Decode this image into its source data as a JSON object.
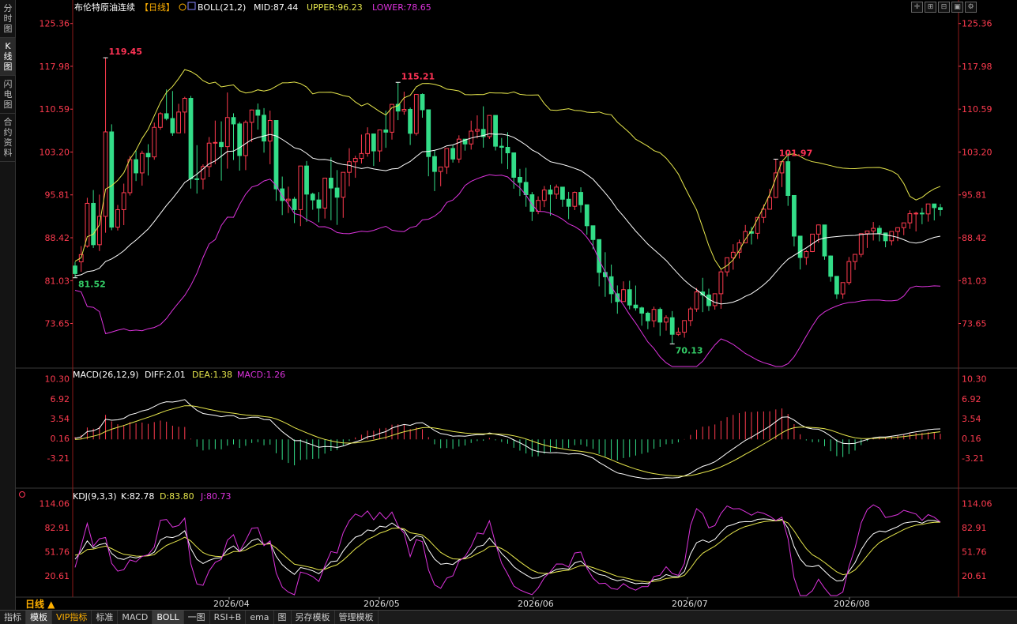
{
  "sidebar": {
    "tabs": [
      {
        "label": "分时图",
        "active": false
      },
      {
        "label": "K线图",
        "active": true
      },
      {
        "label": "闪电图",
        "active": false
      },
      {
        "label": "合约资料",
        "active": false
      }
    ]
  },
  "toolbar_icons": [
    "crosshair-icon",
    "zoom-in-icon",
    "zoom-out-icon",
    "fit-icon",
    "settings-icon"
  ],
  "price_panel": {
    "title": "布伦特原油连续",
    "period_tag": "【日线】",
    "indicator": "BOLL(21,2)",
    "mid_label": "MID:87.44",
    "upper_label": "UPPER:96.23",
    "lower_label": "LOWER:78.65",
    "axis_ticks": [
      "125.36",
      "117.98",
      "110.59",
      "103.20",
      "95.81",
      "88.42",
      "81.03",
      "73.65"
    ],
    "annotations": [
      {
        "text": "119.45",
        "color": "#ff3355"
      },
      {
        "text": "115.21",
        "color": "#ff3355"
      },
      {
        "text": "101.97",
        "color": "#ff3355"
      },
      {
        "text": "81.52",
        "color": "#33cc66"
      },
      {
        "text": "70.13",
        "color": "#33cc66"
      }
    ]
  },
  "macd_panel": {
    "indicator": "MACD(26,12,9)",
    "diff_label": "DIFF:2.01",
    "dea_label": "DEA:1.38",
    "macd_label": "MACD:1.26",
    "axis_ticks": [
      "10.30",
      "6.92",
      "3.54",
      "0.16",
      "-3.21"
    ]
  },
  "kdj_panel": {
    "indicator": "KDJ(9,3,3)",
    "k_label": "K:82.78",
    "d_label": "D:83.80",
    "j_label": "J:80.73",
    "axis_ticks": [
      "114.06",
      "82.91",
      "51.76",
      "20.61"
    ]
  },
  "x_axis": {
    "period_button": "日线 ▲",
    "dates": [
      "2026/04",
      "2026/05",
      "2026/06",
      "2026/07",
      "2026/08"
    ]
  },
  "bottom_tabs": [
    {
      "label": "指标",
      "active": false
    },
    {
      "label": "模板",
      "active": true
    },
    {
      "label": "VIP指标",
      "active": false,
      "vip": true
    },
    {
      "label": "标准",
      "active": false
    },
    {
      "label": "MACD",
      "active": false
    },
    {
      "label": "BOLL",
      "active": true
    },
    {
      "label": "一图",
      "active": false
    },
    {
      "label": "RSI+B",
      "active": false
    },
    {
      "label": "ema",
      "active": false
    },
    {
      "label": "图",
      "active": false
    },
    {
      "label": "另存模板",
      "active": false
    },
    {
      "label": "管理模板",
      "active": false
    }
  ],
  "colors": {
    "up": "#ff3b4f",
    "down": "#33dd88",
    "mid": "#ffffff",
    "upper": "#e6e64c",
    "lower": "#dd33dd",
    "axis": "#ff3b4f"
  },
  "chart_data": {
    "type": "candlestick",
    "instrument": "布伦特原油连续",
    "period": "日线",
    "price_range": [
      66.5,
      127.5
    ],
    "candles_ohlc": [
      [
        83.56,
        84.27,
        82.24,
        81.52
      ],
      [
        84.27,
        86.98,
        85.52,
        82.56
      ],
      [
        86.98,
        95.31,
        94.35,
        86.72
      ],
      [
        94.35,
        96.65,
        87.22,
        86.66
      ],
      [
        87.22,
        95.86,
        92.11,
        86.13
      ],
      [
        92.11,
        119.45,
        106.67,
        89.29
      ],
      [
        106.67,
        107.97,
        90.25,
        89.72
      ],
      [
        90.25,
        94.07,
        93.26,
        89.67
      ],
      [
        93.26,
        97.75,
        96.19,
        90.6
      ],
      [
        96.19,
        102.51,
        101.89,
        95.7
      ],
      [
        101.89,
        103.43,
        99.6,
        98.2
      ],
      [
        99.6,
        103.43,
        102.97,
        97.4
      ],
      [
        102.97,
        104.55,
        102.36,
        99.15
      ],
      [
        102.36,
        108.27,
        107.45,
        101.88
      ],
      [
        107.45,
        110.07,
        109.81,
        107.04
      ],
      [
        109.81,
        113.99,
        108.98,
        108.67
      ],
      [
        108.98,
        113.71,
        106.51,
        105.99
      ],
      [
        106.51,
        111.51,
        110.09,
        106.53
      ],
      [
        110.09,
        112.72,
        112.45,
        106.42
      ],
      [
        112.45,
        112.87,
        98.59,
        96.9
      ],
      [
        98.59,
        104.38,
        98.53,
        96.04
      ],
      [
        98.53,
        101.07,
        100.69,
        96.76
      ],
      [
        100.69,
        105.78,
        104.73,
        98.91
      ],
      [
        104.73,
        108.62,
        104.86,
        101.12
      ],
      [
        104.86,
        108.49,
        104.13,
        98.27
      ],
      [
        104.13,
        113.46,
        109.15,
        100.33
      ],
      [
        109.15,
        109.88,
        108.04,
        101.82
      ],
      [
        108.04,
        108.4,
        102.59,
        99.99
      ],
      [
        102.59,
        108.66,
        108.32,
        100.08
      ],
      [
        108.32,
        110.52,
        110.45,
        104.91
      ],
      [
        110.45,
        111.56,
        109.54,
        107.06
      ],
      [
        109.54,
        110.77,
        105.09,
        103.09
      ],
      [
        105.09,
        110.34,
        108.64,
        101.1
      ],
      [
        108.64,
        100.88,
        96.85,
        94.78
      ],
      [
        96.85,
        98.97,
        94.84,
        92.33
      ],
      [
        94.84,
        97.23,
        95.07,
        92.69
      ],
      [
        95.07,
        95.47,
        93.27,
        90.95
      ],
      [
        93.27,
        92.82,
        100.79,
        90.43
      ],
      [
        100.79,
        101.65,
        95.94,
        91.18
      ],
      [
        95.94,
        96.19,
        94.94,
        93.25
      ],
      [
        94.94,
        96.29,
        93.54,
        91.09
      ],
      [
        93.54,
        98.51,
        98.7,
        91.73
      ],
      [
        98.7,
        102.27,
        96.99,
        91.43
      ],
      [
        96.99,
        100.09,
        95.41,
        90.64
      ],
      [
        95.41,
        95.59,
        99.7,
        91.86
      ],
      [
        99.7,
        103.86,
        101.53,
        97.29
      ],
      [
        101.53,
        102.56,
        102.1,
        98.76
      ],
      [
        102.1,
        106.21,
        102.94,
        101.23
      ],
      [
        102.94,
        107.46,
        106.32,
        102.4
      ],
      [
        106.32,
        106.18,
        103.39,
        100.79
      ],
      [
        103.39,
        106.32,
        107.01,
        101.52
      ],
      [
        107.01,
        110.33,
        106.62,
        103.93
      ],
      [
        106.62,
        109.01,
        111.42,
        105.34
      ],
      [
        111.42,
        115.21,
        110.26,
        108.7
      ],
      [
        110.26,
        113.6,
        110.55,
        109.64
      ],
      [
        110.55,
        110.86,
        106.42,
        104.41
      ],
      [
        106.42,
        108.57,
        113.13,
        106.04
      ],
      [
        113.13,
        113.31,
        110.48,
        109.11
      ],
      [
        110.48,
        107.17,
        102.42,
        99.02
      ],
      [
        102.42,
        103.49,
        99.85,
        96.46
      ],
      [
        99.85,
        100.51,
        100.62,
        97.3
      ],
      [
        100.62,
        102.72,
        103.82,
        99.43
      ],
      [
        103.82,
        104.39,
        101.99,
        101.38
      ],
      [
        101.99,
        106.08,
        105.42,
        101.33
      ],
      [
        105.42,
        105.42,
        104.59,
        103.44
      ],
      [
        104.59,
        108.61,
        106.8,
        103.62
      ],
      [
        106.8,
        109.52,
        107.1,
        105.55
      ],
      [
        107.1,
        111.08,
        105.85,
        103.95
      ],
      [
        105.85,
        109.46,
        109.51,
        105.45
      ],
      [
        109.51,
        108.86,
        104.2,
        103.47
      ],
      [
        104.2,
        105.62,
        104.01,
        101.2
      ],
      [
        104.01,
        106.62,
        103.06,
        100.25
      ],
      [
        103.06,
        102.25,
        98.84,
        96.88
      ],
      [
        98.84,
        100.3,
        97.97,
        95.61
      ],
      [
        97.97,
        100.48,
        95.84,
        93.77
      ],
      [
        95.84,
        96.3,
        92.98,
        91.31
      ],
      [
        92.98,
        95.56,
        94.86,
        92.48
      ],
      [
        94.86,
        97.34,
        96.66,
        93.71
      ],
      [
        96.66,
        97.55,
        95.94,
        92.22
      ],
      [
        95.94,
        97.6,
        97.15,
        95.1
      ],
      [
        97.15,
        96.79,
        95.06,
        93.76
      ],
      [
        95.06,
        96.33,
        93.84,
        91.63
      ],
      [
        93.84,
        96.4,
        96.24,
        93.19
      ],
      [
        96.24,
        97.12,
        94.11,
        92.74
      ],
      [
        94.11,
        93.33,
        90.49,
        88.94
      ],
      [
        90.49,
        90.38,
        88.11,
        86.44
      ],
      [
        88.11,
        85.86,
        82.45,
        80.05
      ],
      [
        82.45,
        85.93,
        81.7,
        78.24
      ],
      [
        81.7,
        83.8,
        78.77,
        77.15
      ],
      [
        78.77,
        80.2,
        77.42,
        75.33
      ],
      [
        77.42,
        80.91,
        79.47,
        77.6
      ],
      [
        79.47,
        81.01,
        76.82,
        76.08
      ],
      [
        76.82,
        80.18,
        76.33,
        75.85
      ],
      [
        76.33,
        76.55,
        75.42,
        73.26
      ],
      [
        75.42,
        75.68,
        74.11,
        72.66
      ],
      [
        74.11,
        76.55,
        76.07,
        72.99
      ],
      [
        76.07,
        76.39,
        73.88,
        71.5
      ],
      [
        73.88,
        75.06,
        74.64,
        72.41
      ],
      [
        74.64,
        75.78,
        71.78,
        70.13
      ],
      [
        71.78,
        72.94,
        72.14,
        71.51
      ],
      [
        72.14,
        72.96,
        74.15,
        71.2
      ],
      [
        74.15,
        76.49,
        76.15,
        73.19
      ],
      [
        76.15,
        79.76,
        79.08,
        75.65
      ],
      [
        79.08,
        81.51,
        78.56,
        75.6
      ],
      [
        78.56,
        79.64,
        76.72,
        75.81
      ],
      [
        76.72,
        77.39,
        78.77,
        76.03
      ],
      [
        78.77,
        83.08,
        82.54,
        76.18
      ],
      [
        82.54,
        84.36,
        84.98,
        81.75
      ],
      [
        84.98,
        87.31,
        85.92,
        82.92
      ],
      [
        85.92,
        88.11,
        87.54,
        84.84
      ],
      [
        87.54,
        90.63,
        89.49,
        87.6
      ],
      [
        89.49,
        90.3,
        89.19,
        87.26
      ],
      [
        89.19,
        91.5,
        91.93,
        88.19
      ],
      [
        91.93,
        94.16,
        93.34,
        90.98
      ],
      [
        93.34,
        96.86,
        95.36,
        93.35
      ],
      [
        95.36,
        101.97,
        99.6,
        95.27
      ],
      [
        99.6,
        100.48,
        101.54,
        97.16
      ],
      [
        101.54,
        103.07,
        95.71,
        93.92
      ],
      [
        95.71,
        94.72,
        88.7,
        86.94
      ],
      [
        88.7,
        88.58,
        85.02,
        82.95
      ],
      [
        85.02,
        86.3,
        86.04,
        83.75
      ],
      [
        86.04,
        87.71,
        89.05,
        85.95
      ],
      [
        89.05,
        90.69,
        90.63,
        87.57
      ],
      [
        90.63,
        88.73,
        85.28,
        84.63
      ],
      [
        85.28,
        85.37,
        81.77,
        80.85
      ],
      [
        81.77,
        81.16,
        78.74,
        77.88
      ],
      [
        78.74,
        80.44,
        80.69,
        77.9
      ],
      [
        80.69,
        85.1,
        84.32,
        80.29
      ],
      [
        84.32,
        85.04,
        85.56,
        82.87
      ],
      [
        85.56,
        88.46,
        89.13,
        85.07
      ],
      [
        89.13,
        89.28,
        89.59,
        86.67
      ],
      [
        89.59,
        91.14,
        90.05,
        87.95
      ],
      [
        90.05,
        90.55,
        89.25,
        87.8
      ],
      [
        89.25,
        89.15,
        87.9,
        86.78
      ],
      [
        87.9,
        89.43,
        89.51,
        87.12
      ],
      [
        89.51,
        90.17,
        90.16,
        87.85
      ],
      [
        90.16,
        90.65,
        90.99,
        88.86
      ],
      [
        90.99,
        93.14,
        92.57,
        89.96
      ],
      [
        92.57,
        92.9,
        92.66,
        89.51
      ],
      [
        92.66,
        93.57,
        92.53,
        90.76
      ],
      [
        92.53,
        94.13,
        94.25,
        91.2
      ],
      [
        94.25,
        94.05,
        93.61,
        91.41
      ],
      [
        93.61,
        94.26,
        93.26,
        92.18
      ]
    ],
    "boll_mid_last": 87.44,
    "boll_upper_last": 96.23,
    "boll_lower_last": 78.65,
    "macd": {
      "diff_last": 2.01,
      "dea_last": 1.38,
      "macd_last": 1.26,
      "range": [
        -7.5,
        10.8
      ]
    },
    "kdj": {
      "k_last": 82.78,
      "d_last": 83.8,
      "j_last": 80.73,
      "range": [
        -5,
        124
      ]
    },
    "x_ticks": [
      "2026/04",
      "2026/05",
      "2026/06",
      "2026/07",
      "2026/08"
    ]
  }
}
